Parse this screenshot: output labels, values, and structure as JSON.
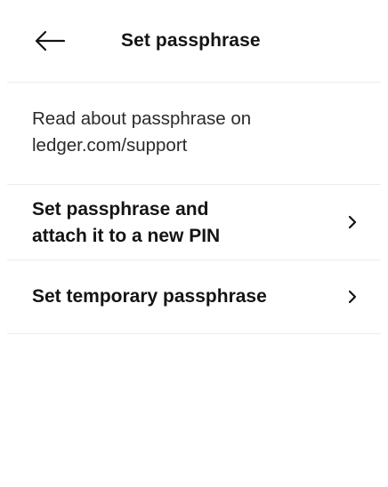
{
  "header": {
    "back_icon": "arrow-left-icon",
    "title": "Set passphrase"
  },
  "info": {
    "line1": "Read about passphrase on",
    "line2": "ledger.com/support"
  },
  "menu": {
    "items": [
      {
        "line1": "Set passphrase and",
        "line2": "attach it to a new PIN",
        "icon": "chevron-right-icon"
      },
      {
        "line1": "Set temporary passphrase",
        "icon": "chevron-right-icon"
      }
    ]
  },
  "colors": {
    "text": "#141414",
    "divider": "#ececec",
    "background": "#ffffff"
  }
}
